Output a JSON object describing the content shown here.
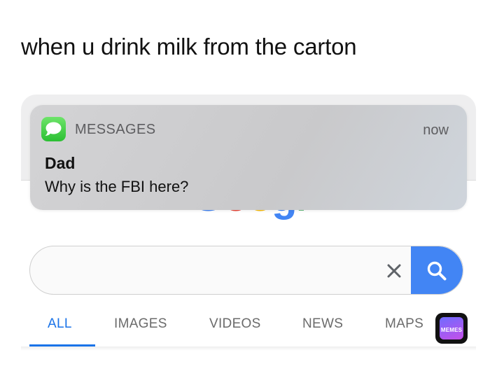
{
  "caption": "when u drink milk from the carton",
  "notification": {
    "app_name": "MESSAGES",
    "time": "now",
    "sender": "Dad",
    "message": "Why is the FBI here?",
    "icon": "messages-app-icon"
  },
  "google": {
    "logo_letters": [
      "G",
      "o",
      "o",
      "g",
      "l",
      "e"
    ],
    "logo_colors": [
      "#4285f4",
      "#ea4335",
      "#fbbc05",
      "#4285f4",
      "#34a853",
      "#ea4335"
    ],
    "search": {
      "value": "",
      "placeholder": "",
      "clear_icon": "close-icon",
      "search_icon": "search-icon",
      "accent": "#4285f4"
    },
    "tabs": [
      {
        "label": "ALL",
        "active": true
      },
      {
        "label": "IMAGES",
        "active": false
      },
      {
        "label": "VIDEOS",
        "active": false
      },
      {
        "label": "NEWS",
        "active": false
      },
      {
        "label": "MAPS",
        "active": false
      }
    ],
    "active_tab_color": "#1a73e8"
  },
  "watermark": {
    "text": "MEMES"
  }
}
